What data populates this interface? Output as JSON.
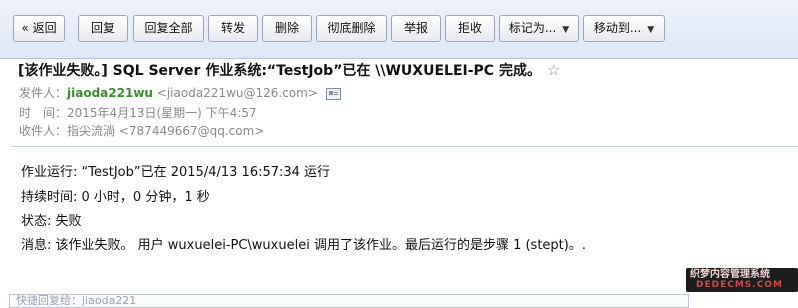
{
  "toolbar": {
    "back": "« 返回",
    "reply": "回复",
    "reply_all": "回复全部",
    "forward": "转发",
    "delete": "删除",
    "delete_permanently": "彻底删除",
    "report": "举报",
    "reject": "拒收",
    "mark_as": "标记为...",
    "move_to": "移动到..."
  },
  "email": {
    "subject": "[该作业失败。] SQL Server 作业系统:“TestJob”已在 \\\\WUXUELEI-PC 完成。",
    "sender_label": "发件人：",
    "sender_name": "jiaoda221wu",
    "sender_email": "<jiaoda221wu@126.com>",
    "time_label": "时　间：",
    "time_value": "2015年4月13日(星期一) 下午4:57",
    "recipient_label": "收件人：",
    "recipient_name": "指尖流淌",
    "recipient_email": "<787449667@qq.com>",
    "body": [
      "作业运行: “TestJob”已在 2015/4/13 16:57:34 运行",
      "持续时间: 0 小时，0 分钟，1 秒",
      "状态: 失败",
      "消息: 该作业失败。   用户 wuxuelei-PC\\wuxuelei 调用了该作业。最后运行的是步骤 1 (stept)。."
    ]
  },
  "reply_box": {
    "text": "快捷回复给：jiaoda221"
  },
  "watermark": {
    "line1": "织梦内容管理系统",
    "line2": "DEDECMS.COM"
  },
  "icons": {
    "star": "star-icon",
    "card": "contact-card-icon",
    "dropdown": "chevron-down-icon"
  }
}
